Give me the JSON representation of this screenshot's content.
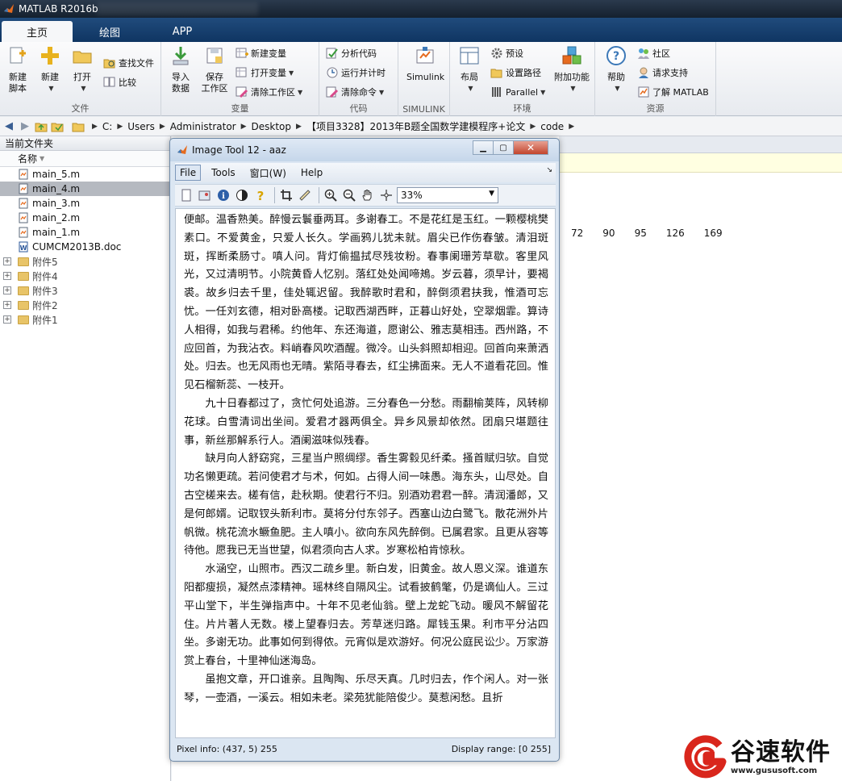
{
  "window": {
    "title": "MATLAB R2016b"
  },
  "ribbon_tabs": [
    {
      "label": "主页",
      "active": true
    },
    {
      "label": "绘图",
      "active": false
    },
    {
      "label": "APP",
      "active": false
    }
  ],
  "ribbon": {
    "file": {
      "label": "文件",
      "new_script": [
        "新建",
        "脚本"
      ],
      "new": "新建",
      "open": "打开",
      "find_files": "查找文件",
      "compare": "比较"
    },
    "variable": {
      "label": "变量",
      "import": [
        "导入",
        "数据"
      ],
      "save": [
        "保存",
        "工作区"
      ],
      "new_var": "新建变量",
      "open_var": "打开变量",
      "clear_ws": "清除工作区"
    },
    "code": {
      "label": "代码",
      "analyze": "分析代码",
      "run_time": "运行并计时",
      "clear_cmd": "清除命令"
    },
    "simulink": {
      "label": "SIMULINK",
      "btn": "Simulink"
    },
    "environment": {
      "label": "环境",
      "layout": "布局",
      "prefs": "预设",
      "set_path": "设置路径",
      "parallel": "Parallel",
      "addons": "附加功能"
    },
    "resources": {
      "label": "资源",
      "help": "帮助",
      "community": "社区",
      "support": "请求支持",
      "learn": "了解 MATLAB"
    }
  },
  "address": {
    "crumbs": [
      "C:",
      "Users",
      "Administrator",
      "Desktop",
      "【项目3328】2013年B题全国数学建模程序+论文",
      "code"
    ]
  },
  "folder_panel": {
    "title": "当前文件夹",
    "column_name": "名称",
    "files": [
      {
        "name": "main_5.m",
        "selected": false
      },
      {
        "name": "main_4.m",
        "selected": true
      },
      {
        "name": "main_3.m",
        "selected": false
      },
      {
        "name": "main_2.m",
        "selected": false
      },
      {
        "name": "main_1.m",
        "selected": false
      },
      {
        "name": "CUMCM2013B.doc",
        "selected": false
      }
    ],
    "folders": [
      "附件5",
      "附件4",
      "附件3",
      "附件2",
      "附件1"
    ]
  },
  "background_values": [
    "72",
    "90",
    "95",
    "126",
    "169"
  ],
  "image_tool": {
    "title": "Image Tool 12 - aaz",
    "menus": [
      {
        "label": "File",
        "mnemonic": "F",
        "active": true
      },
      {
        "label": "Tools",
        "mnemonic": "T",
        "active": false
      },
      {
        "label": "窗口(W)",
        "mnemonic": "",
        "active": false
      },
      {
        "label": "Help",
        "mnemonic": "H",
        "active": false
      }
    ],
    "zoom": "33%",
    "status_pixel": "Pixel info: (437, 5)  255",
    "status_range": "Display range: [0 255]",
    "paragraphs": [
      {
        "indent": false,
        "text": "便邮。温香熟美。醉慢云鬟垂两耳。多谢春工。不是花红是玉红。一颗樱桃樊素口。不爱黄金，只爱人长久。学画鸦儿犹未就。眉尖已作伤春皱。清泪斑斑，挥断柔肠寸。嗔人问。背灯偷揾拭尽残妆粉。春事阑珊芳草歇。客里风光，又过清明节。小院黄昏人忆别。落红处处闻啼鴂。岁云暮，须早计，要褐裘。故乡归去千里，佳处辄迟留。我醉歌时君和，醉倒须君扶我，惟酒可忘忧。一任刘玄德，相对卧高楼。记取西湖西畔，正暮山好处，空翠烟霏。算诗人相得，如我与君稀。约他年、东还海道，愿谢公、雅志莫相违。西州路，不应回首，为我沾衣。料峭春风吹酒醒。微冷。山头斜照却相迎。回首向来萧洒处。归去。也无风雨也无晴。紫陌寻春去，红尘拂面来。无人不道看花回。惟见石榴新蕊、一枝开。"
      },
      {
        "indent": true,
        "text": "九十日春都过了，贪忙何处追游。三分春色一分愁。雨翻榆荚阵，风转柳花球。白雪清词出坐间。爱君才器两俱全。异乡风景却依然。团扇只堪题往事，新丝那解系行人。酒阑滋味似残春。"
      },
      {
        "indent": true,
        "text": "缺月向人舒窈窕，三星当户照绸缪。香生雾縠见纤柔。搔首赋归欤。自觉功名懒更疏。若问使君才与术，何如。占得人间一味愚。海东头，山尽处。自古空槎来去。槎有信，赴秋期。使君行不归。别酒劝君君一醉。清润潘郎，又是何郎婿。记取钗头新利市。莫将分付东邻子。西塞山边白鹭飞。散花洲外片帆微。桃花流水鳜鱼肥。主人嗔小。欲向东风先醉倒。已属君家。且更从容等待他。愿我已无当世望，似君须向古人求。岁寒松柏肯惊秋。"
      },
      {
        "indent": true,
        "text": "水涵空，山照市。西汉二疏乡里。新白发，旧黄金。故人恩义深。谁道东阳都瘦损，凝然点漆精神。瑶林终自隔风尘。试看披鹤氅，仍是谪仙人。三过平山堂下，半生弹指声中。十年不见老仙翁。壁上龙蛇飞动。暖风不解留花住。片片著人无数。楼上望春归去。芳草迷归路。犀钱玉果。利市平分沾四坐。多谢无功。此事如何到得侬。元宵似是欢游好。何况公庭民讼少。万家游赏上春台，十里神仙迷海岛。"
      },
      {
        "indent": true,
        "text": "虽抱文章，开口谁亲。且陶陶、乐尽天真。几时归去，作个闲人。对一张琴，一壶酒，一溪云。相如未老。梁苑犹能陪俊少。莫惹闲愁。且折"
      }
    ]
  },
  "watermark": {
    "name": "谷速软件",
    "url": "www.gususoft.com"
  },
  "colors": {
    "ribbon_tab_bg": "#204b7c",
    "title_bg": "#14202e",
    "selected_row": "#b5b9c0",
    "close_btn": "#c2452d",
    "wm_red": "#d9261c"
  }
}
